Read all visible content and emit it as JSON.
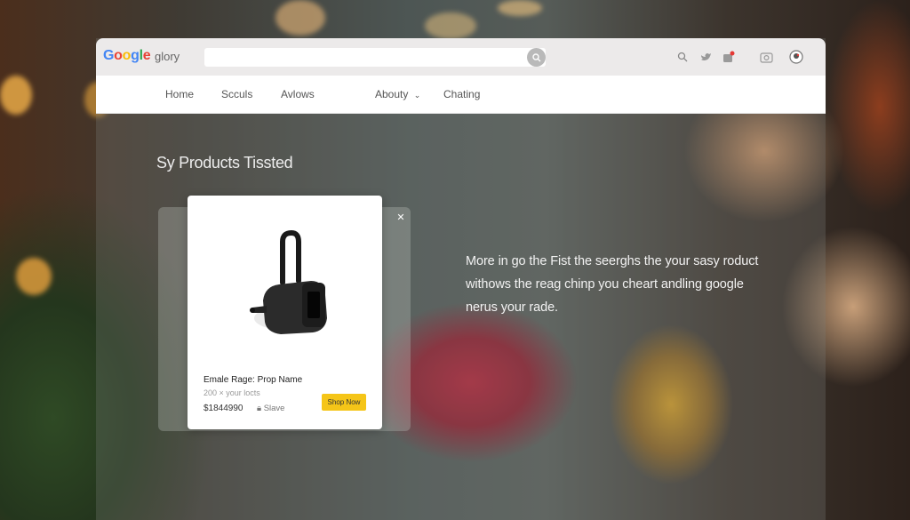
{
  "header": {
    "logo": [
      {
        "char": "G",
        "color": "#4285F4"
      },
      {
        "char": "o",
        "color": "#EA4335"
      },
      {
        "char": "o",
        "color": "#FBBC05"
      },
      {
        "char": "g",
        "color": "#4285F4"
      },
      {
        "char": "l",
        "color": "#34A853"
      },
      {
        "char": "e",
        "color": "#EA4335"
      }
    ],
    "brand_sub": "glory",
    "search": {
      "value": "",
      "placeholder": ""
    },
    "icons": [
      "search-icon",
      "bird-icon",
      "cart-icon",
      "camera-icon",
      "account-icon"
    ]
  },
  "nav": {
    "items": [
      {
        "label": "Home"
      },
      {
        "label": "Scculs"
      },
      {
        "label": "Avlows"
      },
      {
        "label": "Abouty"
      },
      {
        "label": "Chating"
      }
    ]
  },
  "main": {
    "section_title": "Sy Products Tissted",
    "product": {
      "name": "Emale Rage: Prop Name",
      "meta": "200 × your locts",
      "price": "$1844990",
      "save_label": "Slave",
      "shop_label": "Shop Now"
    },
    "promo_lines": [
      "More in go the Fist the seerghs the your sasy roduct",
      "withows the reag chinp you cheart andling google",
      "nerus your rade."
    ]
  },
  "colors": {
    "accent": "#f5c518",
    "notification": "#e53935"
  }
}
